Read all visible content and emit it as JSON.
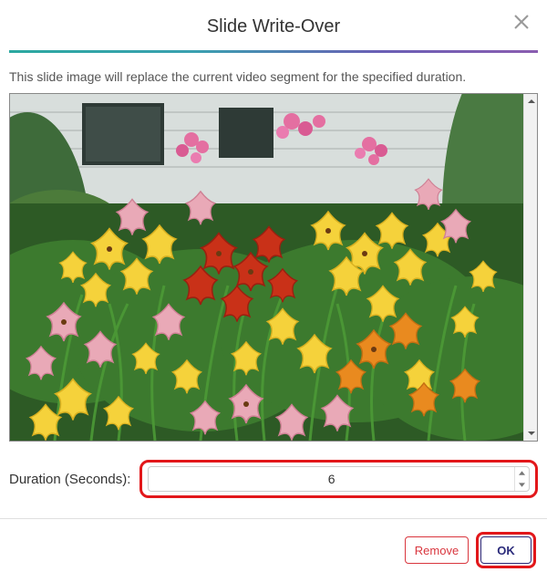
{
  "dialog": {
    "title": "Slide Write-Over",
    "description": "This slide image will replace the current video segment for the specified duration.",
    "image_alt": "flower-garden-photo"
  },
  "duration": {
    "label": "Duration (Seconds):",
    "value": "6"
  },
  "buttons": {
    "remove": "Remove",
    "ok": "OK"
  }
}
